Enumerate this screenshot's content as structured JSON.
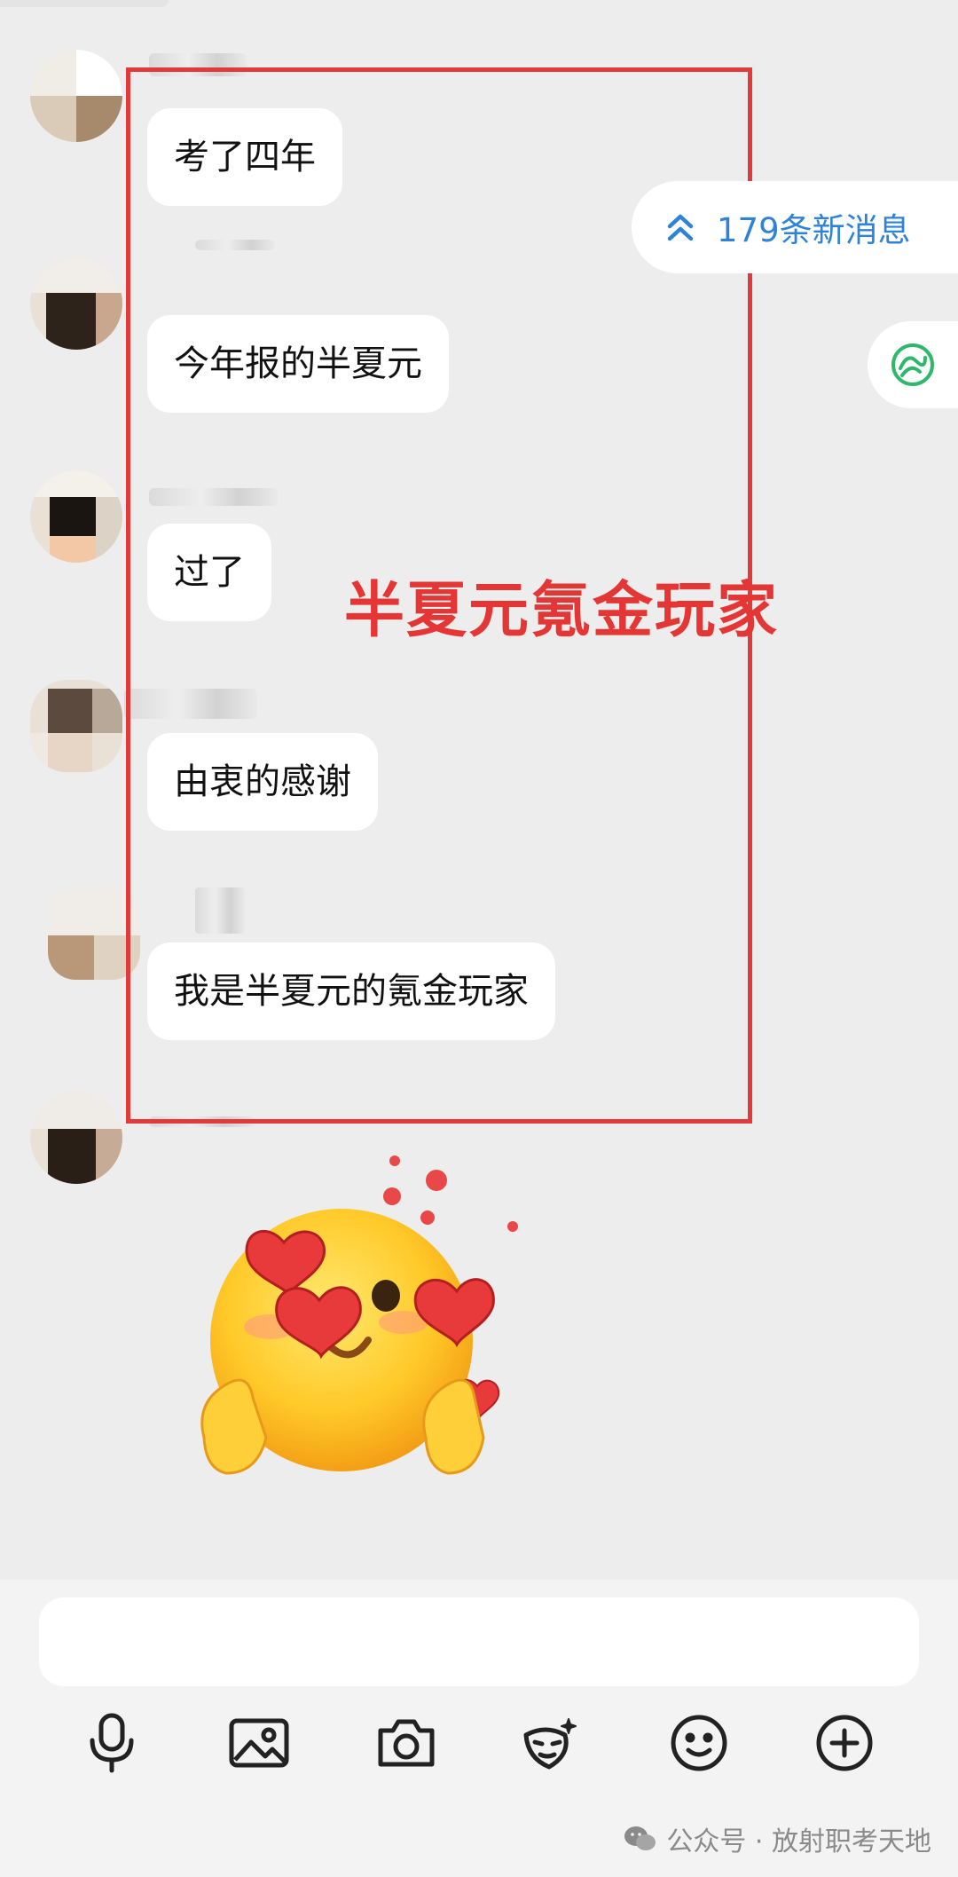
{
  "messages": [
    {
      "text": "考了四年"
    },
    {
      "text": "今年报的半夏元"
    },
    {
      "text": "过了"
    },
    {
      "text": "由衷的感谢"
    },
    {
      "text": "我是半夏元的氪金玩家"
    }
  ],
  "new_messages": {
    "label": "179条新消息"
  },
  "annotation": {
    "text": "半夏元氪金玩家"
  },
  "sticker": {
    "name": "heart-eyes-finger-hearts-emoji"
  },
  "input": {
    "placeholder": ""
  },
  "toolbar": {
    "icons": [
      "microphone-icon",
      "image-icon",
      "camera-icon",
      "emoji-sticker-icon",
      "smiley-icon",
      "plus-icon"
    ]
  },
  "watermark": {
    "text": "公众号 · 放射职考天地"
  },
  "colors": {
    "annotation_red": "#e53636",
    "link_blue": "#2f83d6",
    "bubble": "#ffffff",
    "background": "#ededed"
  }
}
